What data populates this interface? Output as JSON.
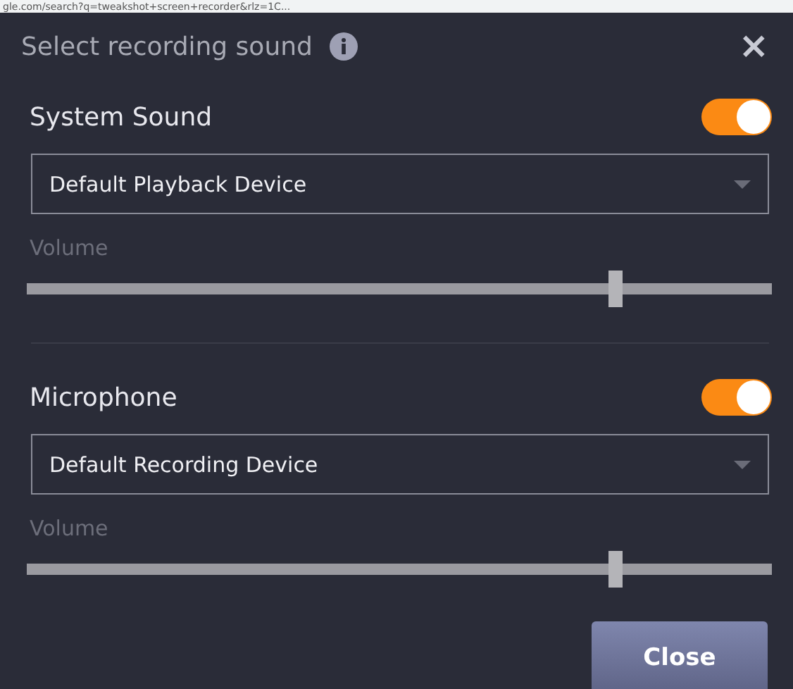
{
  "browser_bar": {
    "address": "gle.com/search?q=tweakshot+screen+recorder&rlz=1C..."
  },
  "dialog": {
    "title": "Select recording sound",
    "close_label": "×"
  },
  "sections": [
    {
      "title": "System Sound",
      "on": true,
      "device": "Default Playback Device",
      "volume_label": "Volume",
      "level": 0.79
    },
    {
      "title": "Microphone",
      "on": true,
      "device": "Default Recording Device",
      "volume_label": "Volume",
      "level": 0.79
    }
  ],
  "buttons": [
    {
      "label": "Close"
    }
  ]
}
